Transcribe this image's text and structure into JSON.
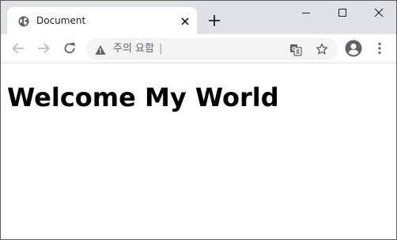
{
  "browser": {
    "tab": {
      "title": "Document"
    },
    "window_controls": [
      "minimize",
      "maximize",
      "close"
    ],
    "omnibox": {
      "security_label": "주의 요함",
      "url": ""
    }
  },
  "page": {
    "heading": "Welcome My World"
  },
  "icons": {
    "favicon": "globe-icon",
    "tab_close": "close-icon",
    "new_tab": "plus-icon",
    "back": "arrow-left-icon",
    "forward": "arrow-right-icon",
    "reload": "reload-icon",
    "security": "warning-icon",
    "translate": "translate-icon",
    "bookmark": "star-icon",
    "profile": "account-icon",
    "menu": "kebab-menu-icon"
  },
  "colors": {
    "tabstrip": "#dee1e6",
    "omnibox": "#f1f3f4",
    "icon": "#5f6368"
  }
}
